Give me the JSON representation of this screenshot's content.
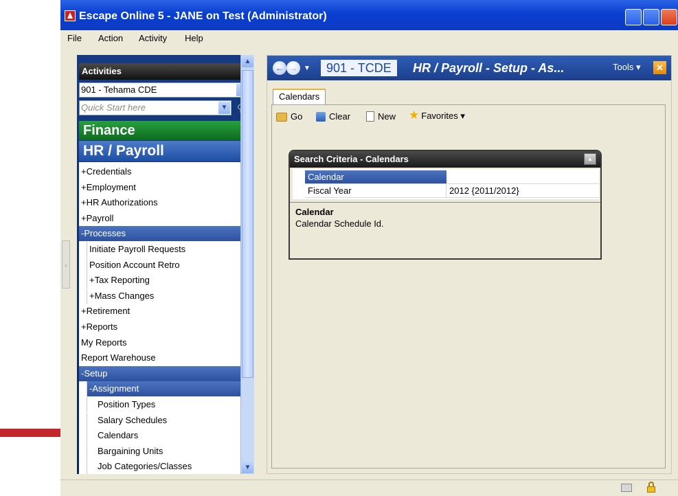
{
  "window": {
    "title": "Escape Online 5 - JANE on Test (Administrator)",
    "menu": [
      "File",
      "Action",
      "Activity",
      "Help"
    ]
  },
  "sidebar": {
    "header": "Activities",
    "district": "901 - Tehama CDE",
    "quick_start_placeholder": "Quick Start here",
    "finance": "Finance",
    "hr_payroll": "HR / Payroll",
    "tree": [
      {
        "label": "+Credentials",
        "indent": 0,
        "selected": false
      },
      {
        "label": "+Employment",
        "indent": 0,
        "selected": false
      },
      {
        "label": "+HR Authorizations",
        "indent": 0,
        "selected": false
      },
      {
        "label": "+Payroll",
        "indent": 0,
        "selected": false
      },
      {
        "label": "-Processes",
        "indent": 0,
        "selected": true
      },
      {
        "label": "Initiate Payroll Requests",
        "indent": 1,
        "selected": false
      },
      {
        "label": "Position Account Retro",
        "indent": 1,
        "selected": false
      },
      {
        "label": "+Tax Reporting",
        "indent": 1,
        "selected": false
      },
      {
        "label": "+Mass Changes",
        "indent": 1,
        "selected": false
      },
      {
        "label": "+Retirement",
        "indent": 0,
        "selected": false
      },
      {
        "label": "+Reports",
        "indent": 0,
        "selected": false
      },
      {
        "label": "My Reports",
        "indent": 0,
        "selected": false
      },
      {
        "label": "Report Warehouse",
        "indent": 0,
        "selected": false
      },
      {
        "label": "-Setup",
        "indent": 0,
        "selected": true
      },
      {
        "label": "-Assignment",
        "indent": 1,
        "selected": true
      },
      {
        "label": "Position Types",
        "indent": 2,
        "selected": false
      },
      {
        "label": "Salary Schedules",
        "indent": 2,
        "selected": false
      },
      {
        "label": "Calendars",
        "indent": 2,
        "selected": false
      },
      {
        "label": "Bargaining Units",
        "indent": 2,
        "selected": false
      },
      {
        "label": "Job Categories/Classes",
        "indent": 2,
        "selected": false
      }
    ]
  },
  "content": {
    "district_code": "901 - TCDE",
    "page_title": "HR / Payroll - Setup - As...",
    "tools_label": "Tools ▾",
    "tab": "Calendars",
    "toolbar": {
      "go": "Go",
      "clear": "Clear",
      "new": "New",
      "favorites": "Favorites ▾"
    },
    "search_criteria": {
      "title": "Search Criteria - Calendars",
      "rows": [
        {
          "label": "Calendar",
          "value": ""
        },
        {
          "label": "Fiscal Year",
          "value": "2012 {2011/2012}"
        }
      ],
      "desc_title": "Calendar",
      "desc_text": "Calendar Schedule Id."
    }
  },
  "colors": {
    "titlebar": "#0a3fd0",
    "finance": "#1a8a30",
    "hr_payroll": "#2d5cb0",
    "selection": "#3d62b0",
    "arrow": "#c2282b"
  }
}
